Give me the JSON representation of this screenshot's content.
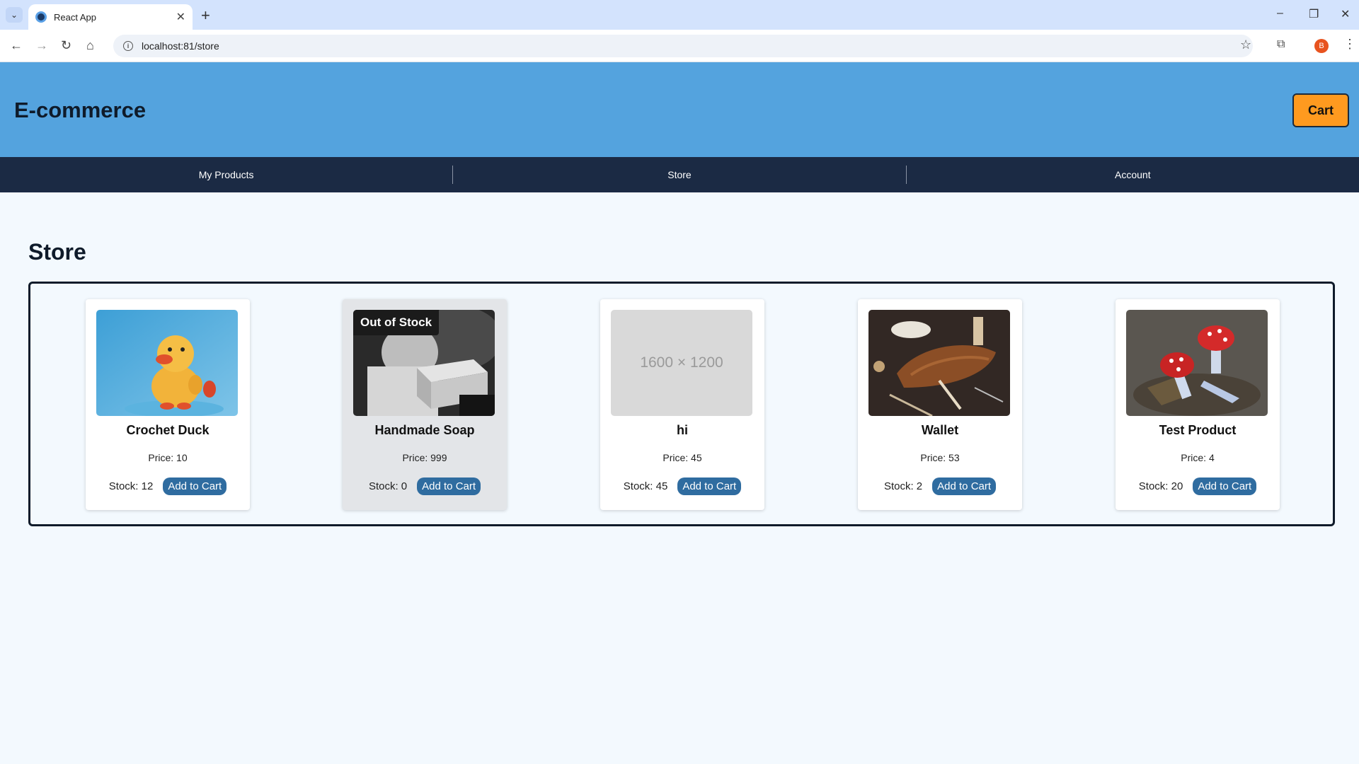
{
  "browser": {
    "tab_title": "React App",
    "tab_close": "✕",
    "new_tab": "+",
    "url": "localhost:81/store",
    "profile_initial": "B",
    "window_controls": [
      "–",
      "❐",
      "✕"
    ],
    "nav_icons": [
      "←",
      "→",
      "↻",
      "⌂"
    ]
  },
  "app": {
    "brand": "E-commerce",
    "cart_label": "Cart",
    "nav": [
      {
        "label": "My Products"
      },
      {
        "label": "Store"
      },
      {
        "label": "Account"
      }
    ]
  },
  "store": {
    "title": "Store",
    "products": [
      {
        "name": "Crochet Duck",
        "price": "Price: 10",
        "stock": "Stock: 12",
        "button": "Add to Cart",
        "image": "crochet-duck-photo"
      },
      {
        "name": "Handmade Soap",
        "price": "Price: 999",
        "stock": "Stock: 0",
        "button": "Add to Cart",
        "image": "soap-photo",
        "badge": "Out of Stock"
      },
      {
        "name": "hi",
        "price": "Price: 45",
        "stock": "Stock: 45",
        "button": "Add to Cart",
        "image": "placeholder",
        "placeholder_text": "1600 × 1200"
      },
      {
        "name": "Wallet",
        "price": "Price: 53",
        "stock": "Stock: 2",
        "button": "Add to Cart",
        "image": "leather-wallet-photo"
      },
      {
        "name": "Test Product",
        "price": "Price: 4",
        "stock": "Stock: 20",
        "button": "Add to Cart",
        "image": "mushroom-photo"
      }
    ]
  },
  "colors": {
    "header_bg": "#54a3de",
    "nav_bg": "#1b2a44",
    "cart_button": "#ff9a1f",
    "add_button": "#2f6ca0",
    "page_bg": "#f3f9fe"
  }
}
